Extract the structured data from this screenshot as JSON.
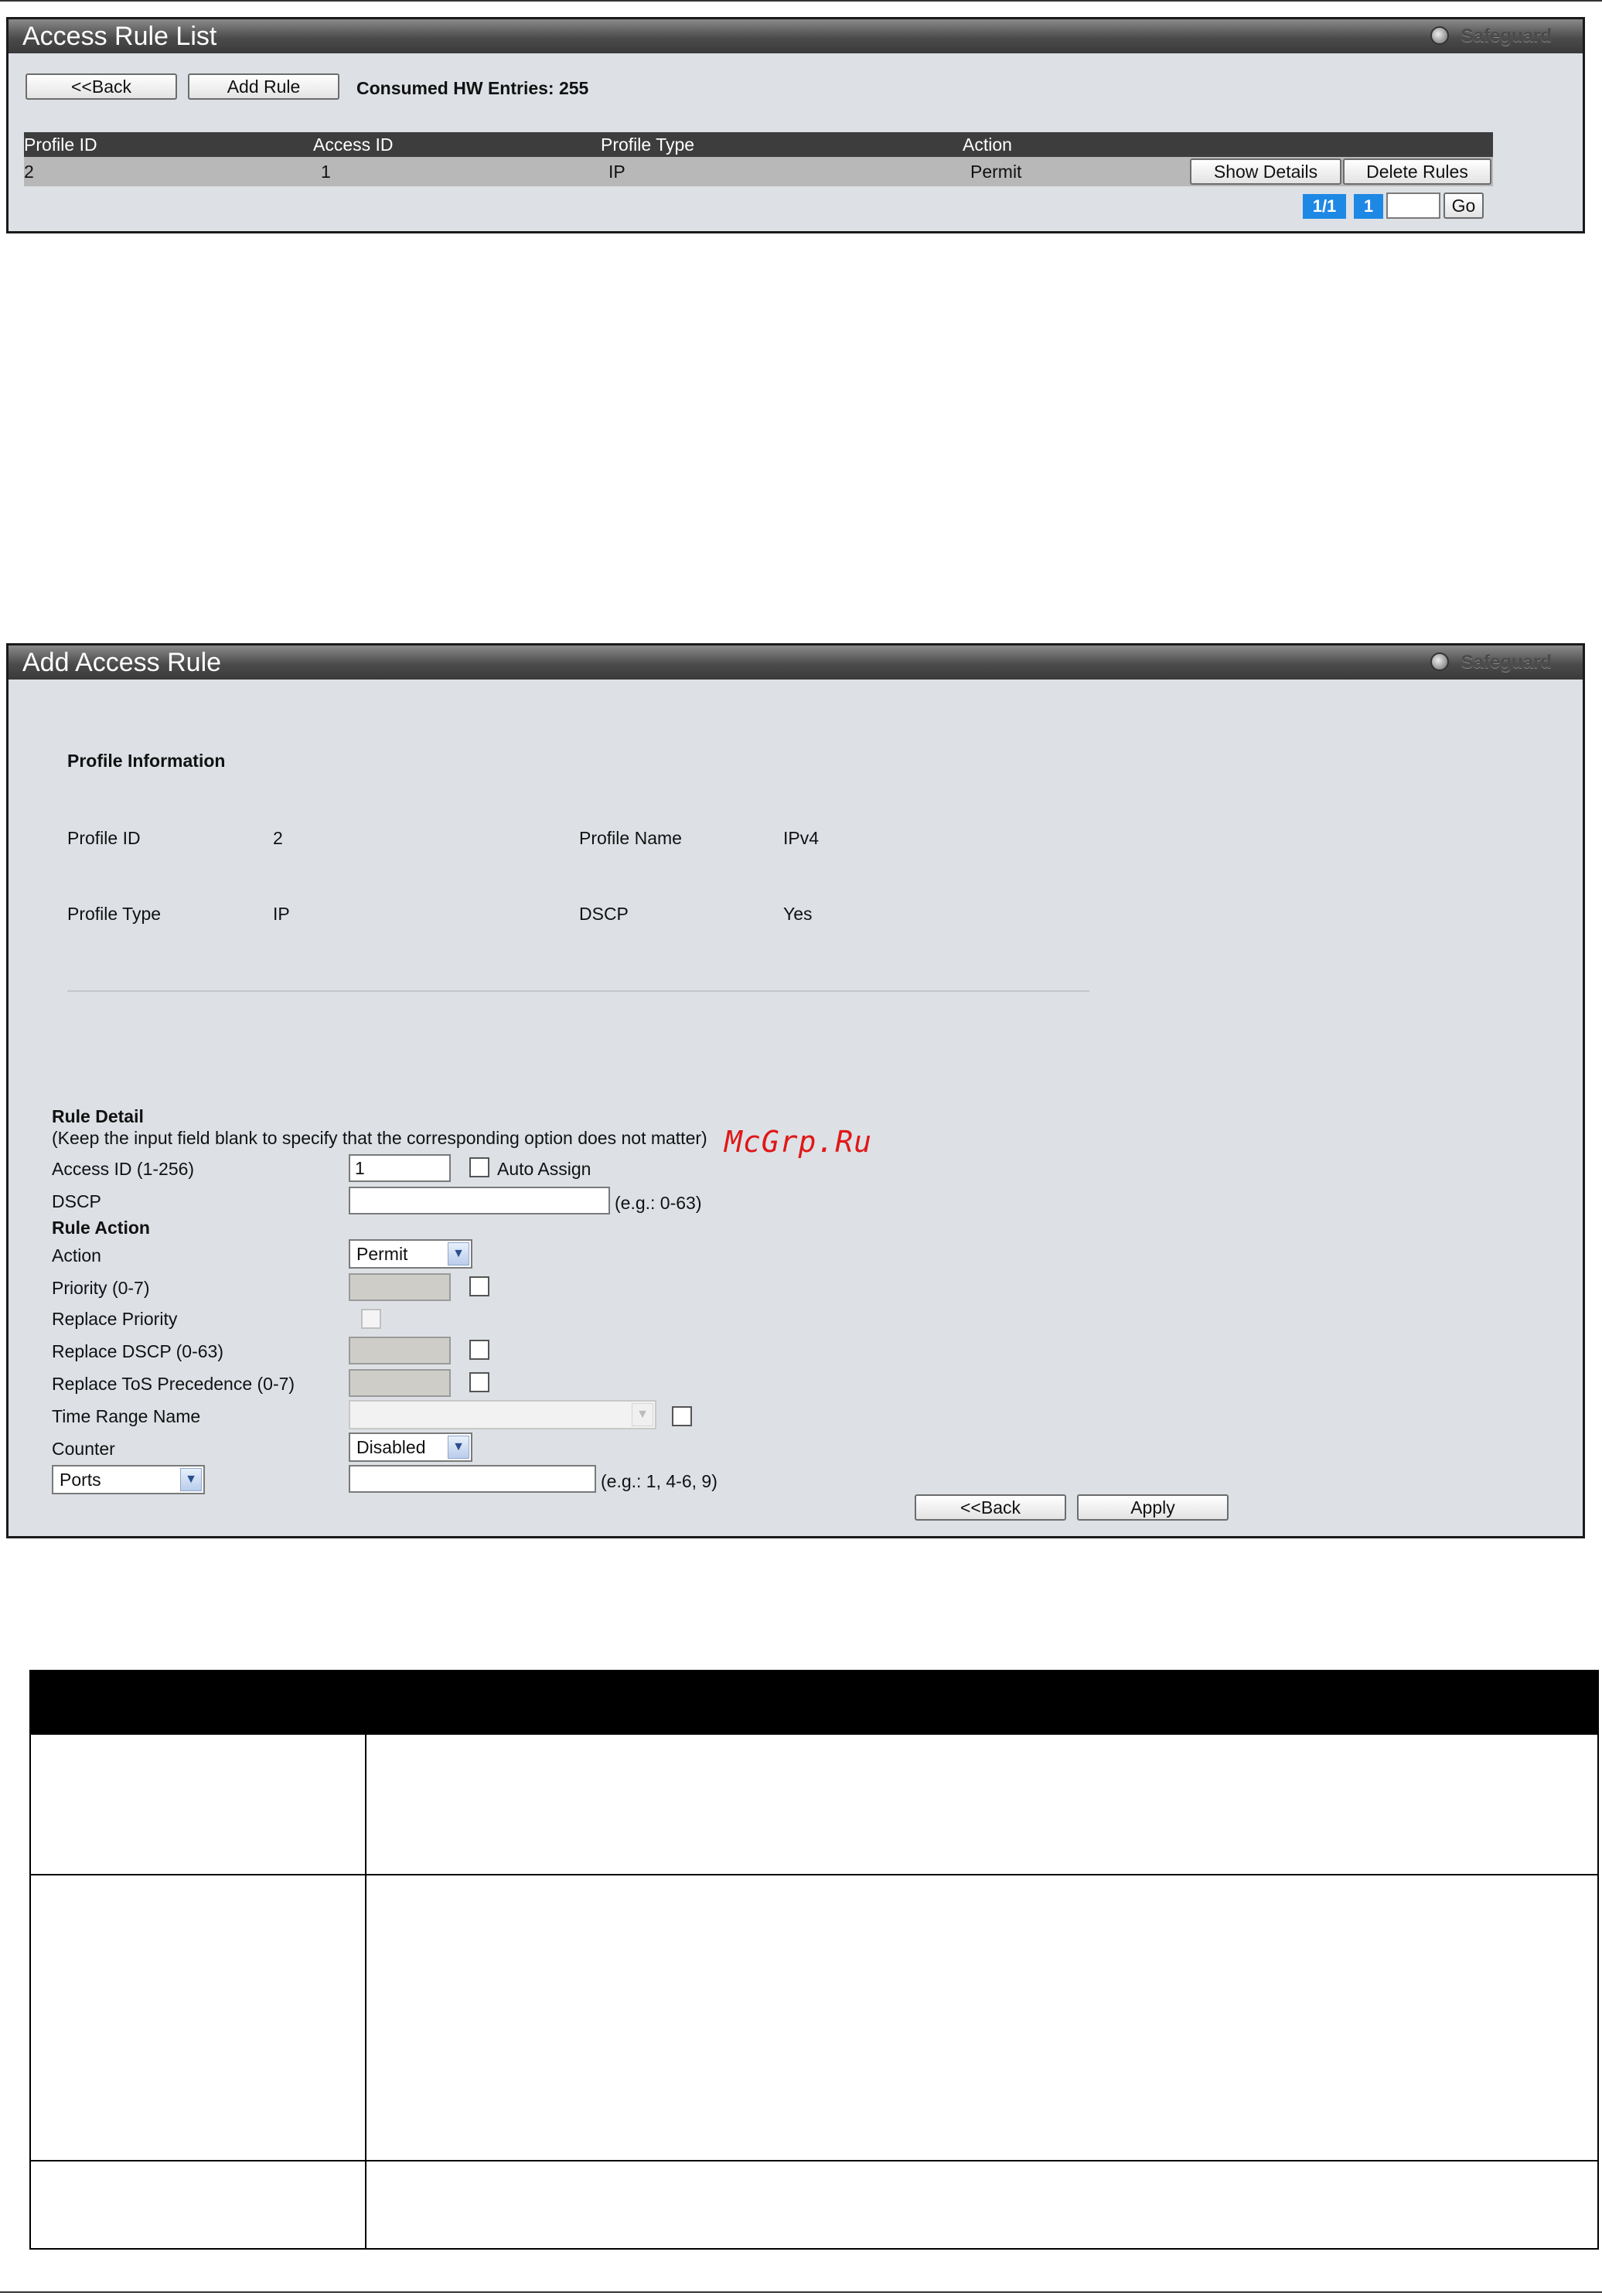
{
  "access_rule_list": {
    "title": "Access Rule List",
    "safeguard": "Safeguard",
    "back_button": "<<Back",
    "add_rule_button": "Add Rule",
    "consumed": "Consumed HW Entries: 255",
    "columns": [
      "Profile ID",
      "Access ID",
      "Profile Type",
      "Action"
    ],
    "rows": [
      {
        "profile_id": "2",
        "access_id": "1",
        "profile_type": "IP",
        "action": "Permit",
        "show_details": "Show Details",
        "delete_rules": "Delete Rules"
      }
    ],
    "pagination": {
      "pages": "1/1",
      "current": "1",
      "input_value": "",
      "go_button": "Go"
    }
  },
  "add_access_rule": {
    "title": "Add Access Rule",
    "safeguard": "Safeguard",
    "profile_information": "Profile Information",
    "profile_id_label": "Profile ID",
    "profile_id_value": "2",
    "profile_name_label": "Profile Name",
    "profile_name_value": "IPv4",
    "profile_type_label": "Profile Type",
    "profile_type_value": "IP",
    "dscp_info_label": "DSCP",
    "dscp_info_value": "Yes",
    "rule_detail": "Rule Detail",
    "rule_detail_note": "(Keep the input field blank to specify that the corresponding option does not matter)",
    "access_id_label": "Access ID (1-256)",
    "access_id_value": "1",
    "auto_assign_label": "Auto Assign",
    "dscp_label": "DSCP",
    "dscp_value": "",
    "dscp_hint": "(e.g.: 0-63)",
    "rule_action": "Rule Action",
    "action_label": "Action",
    "action_value": "Permit",
    "priority_label": "Priority  (0-7)",
    "replace_priority_label": "Replace Priority",
    "replace_dscp_label": "Replace DSCP  (0-63)",
    "replace_tos_label": "Replace ToS Precedence  (0-7)",
    "time_range_label": "Time Range Name",
    "time_range_value": "",
    "counter_label": "Counter",
    "counter_value": "Disabled",
    "ports_select_value": "Ports",
    "ports_value": "",
    "ports_hint": "(e.g.: 1, 4-6, 9)",
    "back_button": "<<Back",
    "apply_button": "Apply"
  },
  "watermark": "McGrp.Ru"
}
